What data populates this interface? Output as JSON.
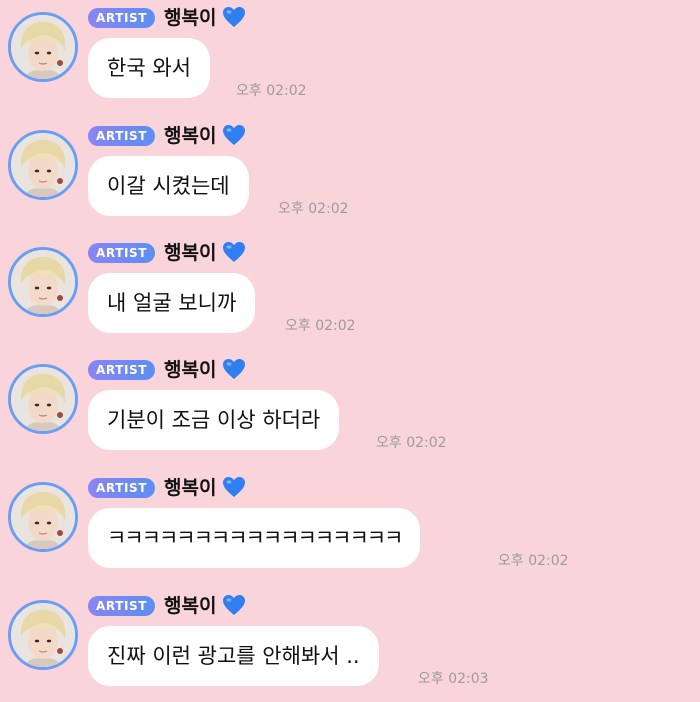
{
  "messages": [
    {
      "badge": "ARTIST",
      "sender": "행복이",
      "heart_icon": "blue-heart-icon",
      "text": "한국 와서",
      "time": "오후 02:02"
    },
    {
      "badge": "ARTIST",
      "sender": "행복이",
      "heart_icon": "blue-heart-icon",
      "text": "이갈 시켰는데",
      "time": "오후 02:02"
    },
    {
      "badge": "ARTIST",
      "sender": "행복이",
      "heart_icon": "blue-heart-icon",
      "text": "내 얼굴 보니까",
      "time": "오후 02:02"
    },
    {
      "badge": "ARTIST",
      "sender": "행복이",
      "heart_icon": "blue-heart-icon",
      "text": "기분이 조금 이상 하더라",
      "time": "오후 02:02"
    },
    {
      "badge": "ARTIST",
      "sender": "행복이",
      "heart_icon": "blue-heart-icon",
      "text": "ㅋㅋㅋㅋㅋㅋㅋㅋㅋㅋㅋㅋㅋㅋㅋㅋㅋ",
      "time": "오후 02:02"
    },
    {
      "badge": "ARTIST",
      "sender": "행복이",
      "heart_icon": "blue-heart-icon",
      "text": "진짜 이런 광고를 안해봐서 ..",
      "time": "오후 02:03"
    }
  ],
  "colors": {
    "background": "#f9d5db",
    "bubble": "#ffffff",
    "avatar_ring": "#6a9ef2",
    "badge_start": "#8a84f5",
    "badge_end": "#5b8ff0",
    "heart": "#2f7ff0",
    "timestamp": "#9b9b9b"
  }
}
